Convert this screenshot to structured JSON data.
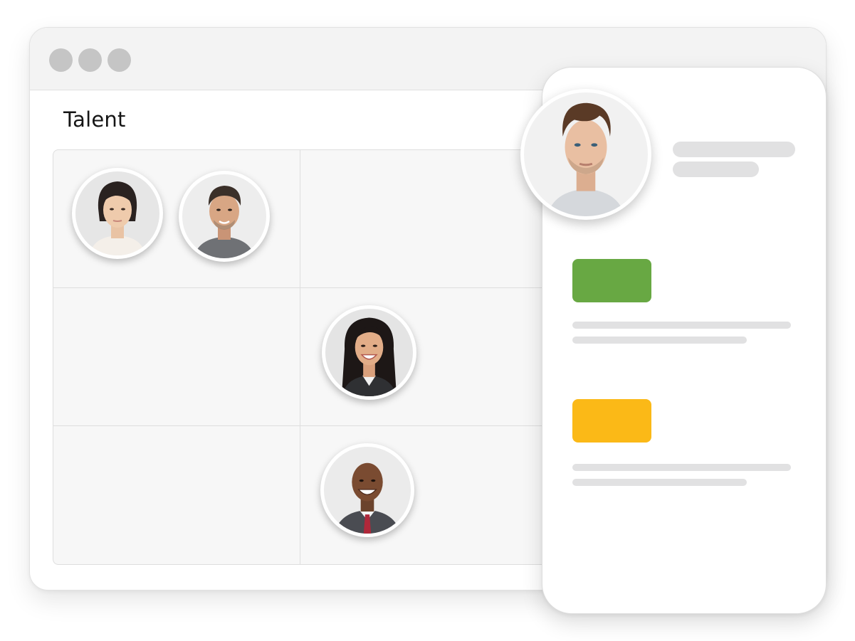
{
  "window": {
    "controls": [
      "window-dot",
      "window-dot",
      "window-dot"
    ]
  },
  "page": {
    "title": "Talent"
  },
  "talent_grid": {
    "rows": 3,
    "columns": 2,
    "people": [
      {
        "name": "avatar-woman-1",
        "cell": "row-1-col-1"
      },
      {
        "name": "avatar-man-1",
        "cell": "row-1-col-1"
      },
      {
        "name": "avatar-woman-2",
        "cell": "row-2-col-2"
      },
      {
        "name": "avatar-man-2",
        "cell": "row-3-col-2"
      }
    ]
  },
  "profile_panel": {
    "avatar": "avatar-man-profile",
    "sections": [
      {
        "status_color": "#68a843"
      },
      {
        "status_color": "#fbb917"
      }
    ]
  },
  "colors": {
    "status_green": "#68a843",
    "status_yellow": "#fbb917",
    "skeleton": "#e1e1e2",
    "window_dots": "#c5c5c5"
  }
}
